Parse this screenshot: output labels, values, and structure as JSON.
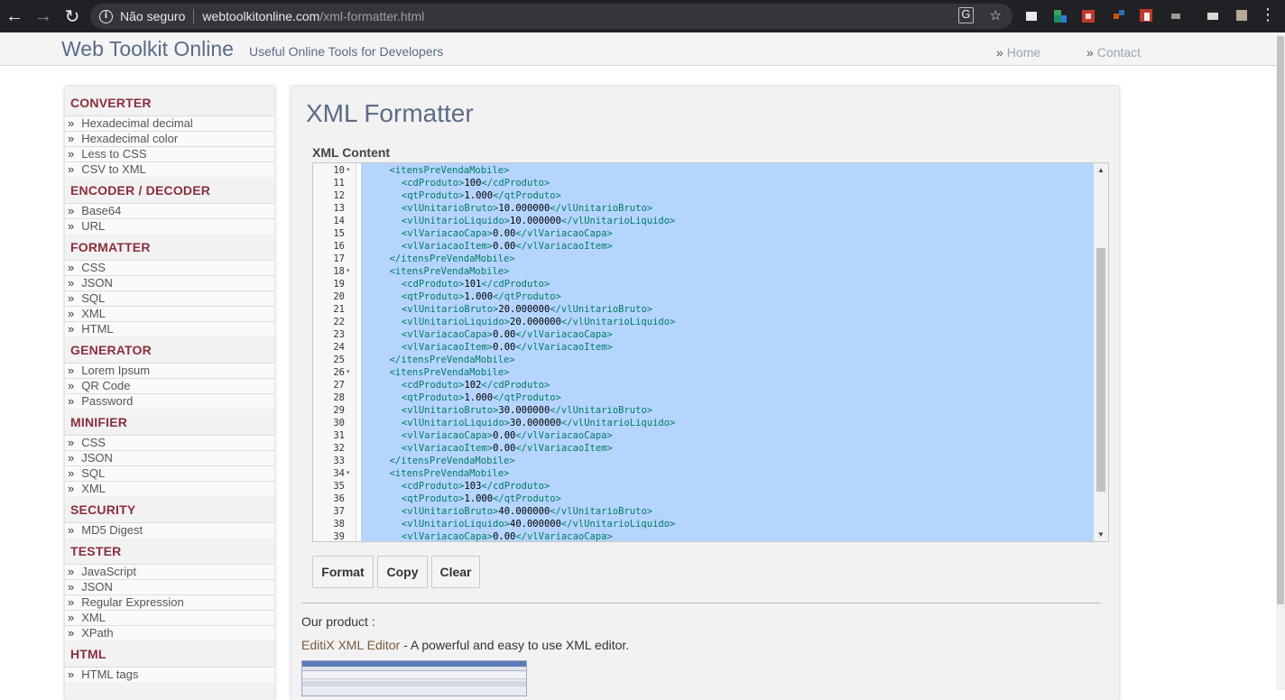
{
  "browser": {
    "security_label": "Não seguro",
    "url_host": "webtoolkitonline.com",
    "url_path": "/xml-formatter.html"
  },
  "header": {
    "title": "Web Toolkit Online",
    "tagline": "Useful Online Tools for Developers",
    "nav": [
      {
        "label": "Home"
      },
      {
        "label": "Contact"
      }
    ],
    "nav_prefix": "»"
  },
  "sidebar": {
    "bullet": "»",
    "sections": [
      {
        "title": "CONVERTER",
        "items": [
          "Hexadecimal decimal",
          "Hexadecimal color",
          "Less to CSS",
          "CSV to XML"
        ]
      },
      {
        "title": "ENCODER / DECODER",
        "items": [
          "Base64",
          "URL"
        ]
      },
      {
        "title": "FORMATTER",
        "items": [
          "CSS",
          "JSON",
          "SQL",
          "XML",
          "HTML"
        ]
      },
      {
        "title": "GENERATOR",
        "items": [
          "Lorem Ipsum",
          "QR Code",
          "Password"
        ]
      },
      {
        "title": "MINIFIER",
        "items": [
          "CSS",
          "JSON",
          "SQL",
          "XML"
        ]
      },
      {
        "title": "SECURITY",
        "items": [
          "MD5 Digest"
        ]
      },
      {
        "title": "TESTER",
        "items": [
          "JavaScript",
          "JSON",
          "Regular Expression",
          "XML",
          "XPath"
        ]
      },
      {
        "title": "HTML",
        "items": [
          "HTML tags"
        ]
      }
    ]
  },
  "main": {
    "title": "XML Formatter",
    "content_label": "XML Content",
    "editor": {
      "lines": [
        {
          "n": "10",
          "fold": true,
          "indent": 2,
          "tag": "itensPreVendaMobile",
          "kind": "open"
        },
        {
          "n": "11",
          "fold": false,
          "indent": 3,
          "tag": "cdProduto",
          "value": "100"
        },
        {
          "n": "12",
          "fold": false,
          "indent": 3,
          "tag": "qtProduto",
          "value": "1.000"
        },
        {
          "n": "13",
          "fold": false,
          "indent": 3,
          "tag": "vlUnitarioBruto",
          "value": "10.000000"
        },
        {
          "n": "14",
          "fold": false,
          "indent": 3,
          "tag": "vlUnitarioLiquido",
          "value": "10.000000"
        },
        {
          "n": "15",
          "fold": false,
          "indent": 3,
          "tag": "vlVariacaoCapa",
          "value": "0.00"
        },
        {
          "n": "16",
          "fold": false,
          "indent": 3,
          "tag": "vlVariacaoItem",
          "value": "0.00"
        },
        {
          "n": "17",
          "fold": false,
          "indent": 2,
          "tag": "itensPreVendaMobile",
          "kind": "close"
        },
        {
          "n": "18",
          "fold": true,
          "indent": 2,
          "tag": "itensPreVendaMobile",
          "kind": "open"
        },
        {
          "n": "19",
          "fold": false,
          "indent": 3,
          "tag": "cdProduto",
          "value": "101"
        },
        {
          "n": "20",
          "fold": false,
          "indent": 3,
          "tag": "qtProduto",
          "value": "1.000"
        },
        {
          "n": "21",
          "fold": false,
          "indent": 3,
          "tag": "vlUnitarioBruto",
          "value": "20.000000"
        },
        {
          "n": "22",
          "fold": false,
          "indent": 3,
          "tag": "vlUnitarioLiquido",
          "value": "20.000000"
        },
        {
          "n": "23",
          "fold": false,
          "indent": 3,
          "tag": "vlVariacaoCapa",
          "value": "0.00"
        },
        {
          "n": "24",
          "fold": false,
          "indent": 3,
          "tag": "vlVariacaoItem",
          "value": "0.00"
        },
        {
          "n": "25",
          "fold": false,
          "indent": 2,
          "tag": "itensPreVendaMobile",
          "kind": "close"
        },
        {
          "n": "26",
          "fold": true,
          "indent": 2,
          "tag": "itensPreVendaMobile",
          "kind": "open"
        },
        {
          "n": "27",
          "fold": false,
          "indent": 3,
          "tag": "cdProduto",
          "value": "102"
        },
        {
          "n": "28",
          "fold": false,
          "indent": 3,
          "tag": "qtProduto",
          "value": "1.000"
        },
        {
          "n": "29",
          "fold": false,
          "indent": 3,
          "tag": "vlUnitarioBruto",
          "value": "30.000000"
        },
        {
          "n": "30",
          "fold": false,
          "indent": 3,
          "tag": "vlUnitarioLiquido",
          "value": "30.000000"
        },
        {
          "n": "31",
          "fold": false,
          "indent": 3,
          "tag": "vlVariacaoCapa",
          "value": "0.00"
        },
        {
          "n": "32",
          "fold": false,
          "indent": 3,
          "tag": "vlVariacaoItem",
          "value": "0.00"
        },
        {
          "n": "33",
          "fold": false,
          "indent": 2,
          "tag": "itensPreVendaMobile",
          "kind": "close"
        },
        {
          "n": "34",
          "fold": true,
          "indent": 2,
          "tag": "itensPreVendaMobile",
          "kind": "open"
        },
        {
          "n": "35",
          "fold": false,
          "indent": 3,
          "tag": "cdProduto",
          "value": "103"
        },
        {
          "n": "36",
          "fold": false,
          "indent": 3,
          "tag": "qtProduto",
          "value": "1.000"
        },
        {
          "n": "37",
          "fold": false,
          "indent": 3,
          "tag": "vlUnitarioBruto",
          "value": "40.000000"
        },
        {
          "n": "38",
          "fold": false,
          "indent": 3,
          "tag": "vlUnitarioLiquido",
          "value": "40.000000"
        },
        {
          "n": "39",
          "fold": false,
          "indent": 3,
          "tag": "vlVariacaoCapa",
          "value": "0.00"
        }
      ]
    },
    "buttons": {
      "format": "Format",
      "copy": "Copy",
      "clear": "Clear"
    },
    "our_product_label": "Our product :",
    "product_link": "EditiX XML Editor",
    "product_desc": " - A powerful and easy to use XML editor."
  },
  "colors": {
    "selection": "#b5d5ff",
    "tag": "#007a66",
    "section_title": "#8b2f3c",
    "brand": "#5a6b86"
  }
}
